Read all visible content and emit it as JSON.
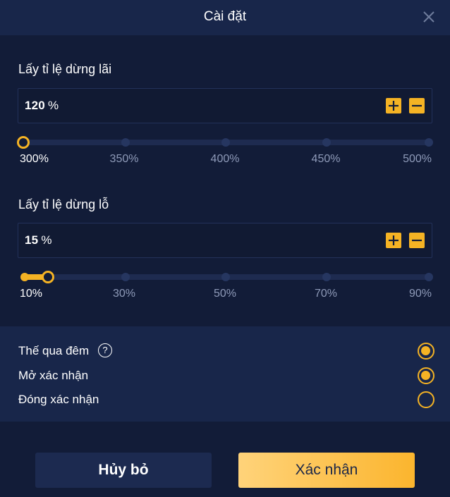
{
  "header": {
    "title": "Cài đặt",
    "close_icon": "close-icon"
  },
  "take_profit": {
    "title": "Lấy tỉ lệ dừng lãi",
    "value": "120",
    "unit": "%",
    "slider": {
      "ticks": [
        "300%",
        "350%",
        "400%",
        "450%",
        "500%"
      ],
      "value": "300%"
    }
  },
  "stop_loss": {
    "title": "Lấy tỉ lệ dừng lỗ",
    "value": "15",
    "unit": "%",
    "slider": {
      "ticks": [
        "10%",
        "30%",
        "50%",
        "70%",
        "90%"
      ],
      "value": "15%"
    }
  },
  "options": [
    {
      "label": "Thế qua đêm",
      "has_help": true,
      "help_icon": "question-circle-icon",
      "checked": true
    },
    {
      "label": "Mở xác nhận",
      "checked": true
    },
    {
      "label": "Đóng xác nhận",
      "checked": false
    }
  ],
  "help_symbol": "?",
  "buttons": {
    "cancel": "Hủy bỏ",
    "confirm": "Xác nhận"
  },
  "colors": {
    "accent": "#f5b324",
    "background": "#121c38",
    "panel": "#18264a"
  }
}
